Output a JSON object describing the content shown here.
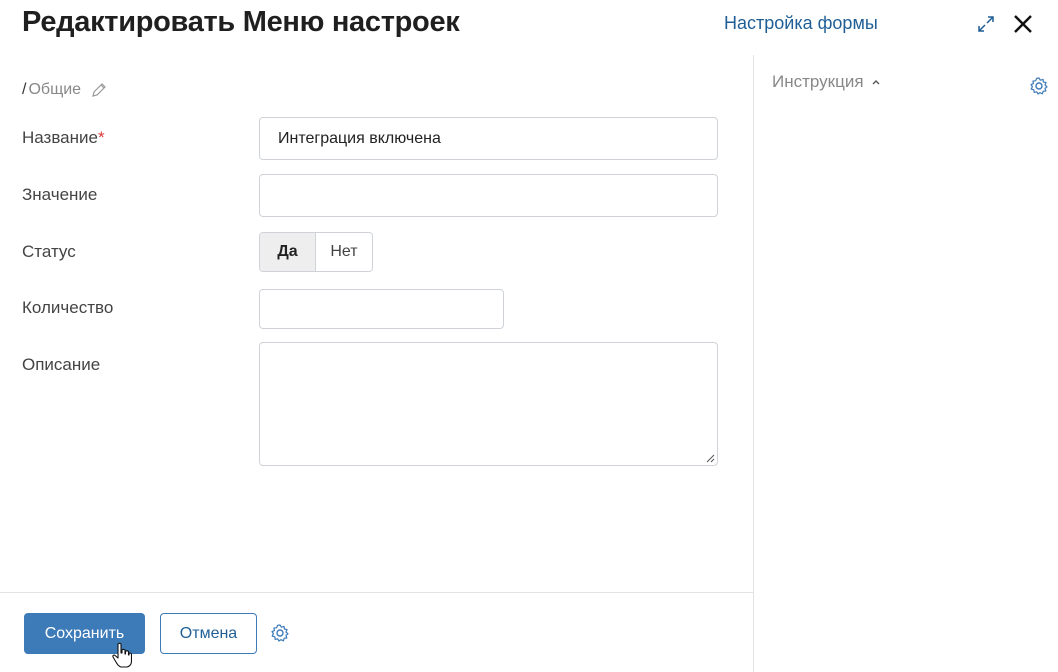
{
  "header": {
    "title": "Редактировать Меню настроек",
    "form_settings_link": "Настройка формы"
  },
  "section": {
    "slash": "/",
    "name": "Общие"
  },
  "fields": {
    "name": {
      "label": "Название",
      "required_mark": "*",
      "value": "Интеграция включена"
    },
    "value": {
      "label": "Значение",
      "value": ""
    },
    "status": {
      "label": "Статус",
      "options": [
        "Да",
        "Нет"
      ],
      "selected": "Да"
    },
    "quantity": {
      "label": "Количество",
      "value": ""
    },
    "description": {
      "label": "Описание",
      "value": ""
    }
  },
  "side_panel": {
    "instruction_label": "Инструкция"
  },
  "footer": {
    "save_label": "Сохранить",
    "cancel_label": "Отмена"
  },
  "colors": {
    "accent": "#3d7ab8",
    "link": "#1f5f96",
    "required": "#d93a3a"
  },
  "icons": [
    "expand-icon",
    "close-icon",
    "pencil-icon",
    "chevron-up-icon",
    "gear-icon",
    "hand-cursor-icon"
  ]
}
